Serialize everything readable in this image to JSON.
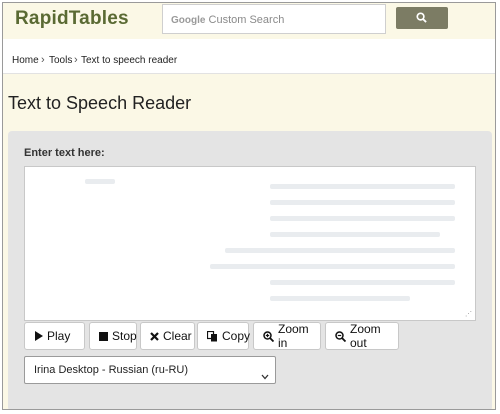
{
  "header": {
    "logo": "RapidTables",
    "search_brand": "Google",
    "search_placeholder": "Custom Search"
  },
  "breadcrumb": [
    "Home",
    "Tools",
    "Text to speech reader"
  ],
  "breadcrumb_separator": "›",
  "page": {
    "title": "Text to Speech Reader",
    "text_label": "Enter text here:"
  },
  "controls": {
    "play": "Play",
    "stop": "Stop",
    "clear": "Clear",
    "copy": "Copy",
    "zoom_in": "Zoom in",
    "zoom_out": "Zoom out"
  },
  "voice_select": {
    "selected": "Irina Desktop - Russian (ru-RU)"
  },
  "icons": {
    "search": "search-icon",
    "play": "play-icon",
    "stop": "stop-icon",
    "clear": "close-icon",
    "copy": "copy-icon",
    "zoom_in": "zoom-in-icon",
    "zoom_out": "zoom-out-icon",
    "dropdown": "chevron-down-icon"
  },
  "colors": {
    "logo": "#5a6a33",
    "header_bg": "#fbf8e6",
    "search_button": "#7c7c64",
    "panel_bg": "#e4e4e4"
  }
}
